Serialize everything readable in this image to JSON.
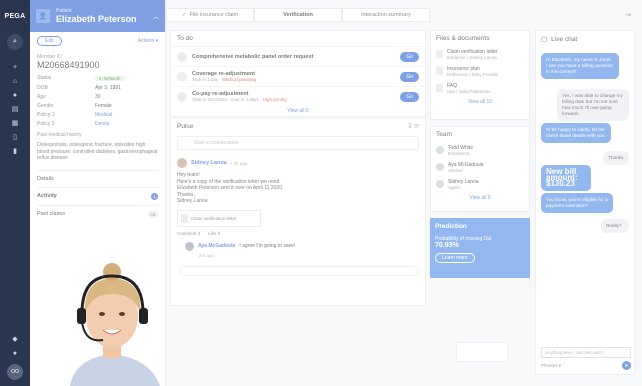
{
  "brand": "PEGA",
  "case": {
    "small": "Patient",
    "name": "Elizabeth Peterson",
    "edit_label": "Edit",
    "actions_label": "Actions ▾",
    "member_label": "Member ID",
    "member_id": "M20668491900",
    "fields": [
      {
        "k": "Status",
        "v": "In Network",
        "style": "badge"
      },
      {
        "k": "DOB",
        "v": "Apr 3, 1991",
        "style": ""
      },
      {
        "k": "Age",
        "v": "30",
        "style": ""
      },
      {
        "k": "Gender",
        "v": "Female",
        "style": ""
      },
      {
        "k": "Policy 1",
        "v": "Medical",
        "style": "blue"
      },
      {
        "k": "Policy 2",
        "v": "Dental",
        "style": "blue"
      }
    ],
    "history_label": "Past medical history",
    "history_text": "Osteoporosis, osteogenic fracture, episodes high blood pressure, controlled diabetes, gastroesophageal reflux disease",
    "sections": [
      {
        "label": "Details",
        "count": ""
      },
      {
        "label": "Activity",
        "count": "1"
      },
      {
        "label": "Past claims",
        "count": "16"
      }
    ]
  },
  "stages": [
    "File insurance claim",
    "Verification",
    "Interaction summary"
  ],
  "todo": {
    "title": "To do",
    "tasks": [
      {
        "title": "Comprehensive metabolic panel order request",
        "sub": "",
        "urgent": "",
        "tag": "",
        "go": "Go"
      },
      {
        "title": "Coverage re-adjustment",
        "sub": "Task in 1 day · ",
        "urgent": "Medical planning",
        "tag": "",
        "go": "Go"
      },
      {
        "title": "Co-pay re-adjustment",
        "sub": "Task in 4/21/2021 · Due in 4 days · ",
        "urgent": "High priority",
        "tag": "",
        "go": "Go"
      }
    ],
    "view": "View all 5"
  },
  "pulse": {
    "title": "Pulse",
    "compose": "Start a conversation",
    "post_name": "Sidney Lanoa",
    "post_time": "• 2h ago",
    "post_body": "Hey team!\nHere's a copy of the verification letter we need.\nElizabeth Peterson sent it over on April 11 2020.\nThanks,\nSidney Lanoa",
    "attach": "Claim verification letter",
    "comment": "Comment 3",
    "like": "Like 0",
    "reply_name": "Aya McGadoula",
    "reply_text": "I agree I'm going to save!",
    "reply_time": "2m ago"
  },
  "files": {
    "title": "Files & documents",
    "items": [
      {
        "a": "Claim verification letter",
        "b": "Evidence / Sidney Lanoa"
      },
      {
        "a": "Insurance plan",
        "b": "Reference / Easy Proxide"
      },
      {
        "a": "FAQ",
        "b": "Use / Julia Pettersson"
      }
    ],
    "view": "View all 10"
  },
  "team": {
    "title": "Team",
    "items": [
      {
        "a": "Todd White",
        "b": "Enrollment"
      },
      {
        "a": "Aya McGadoula",
        "b": "Advisor"
      },
      {
        "a": "Sidney Lanoa",
        "b": "Agent"
      }
    ],
    "view": "View all 8"
  },
  "prediction": {
    "title": "Prediction",
    "text": "Probability of missing Out",
    "pct": "70.93%",
    "btn": "Learn more"
  },
  "chat": {
    "title": "Live chat",
    "messages": [
      {
        "from": "agent",
        "text": "Hi Elizabeth, my name is Janet. I see you have a billing question. Is this correct?"
      },
      {
        "from": "user",
        "text": "Yes, I was able to change my billing date but I'm not sure how much I'll owe going forward."
      },
      {
        "from": "agent",
        "text": "I'll be happy to clarify, let me check those details with you."
      },
      {
        "from": "user",
        "text": "Thanks."
      },
      {
        "from": "agent",
        "text": "New bill amount: $130.23"
      },
      {
        "from": "agent",
        "text": "You know, you're eligible for a payment extension?"
      },
      {
        "from": "user",
        "text": "Really?"
      }
    ],
    "input_placeholder": "Anything else I can help with?",
    "footer_left": "Phrases ▾"
  }
}
